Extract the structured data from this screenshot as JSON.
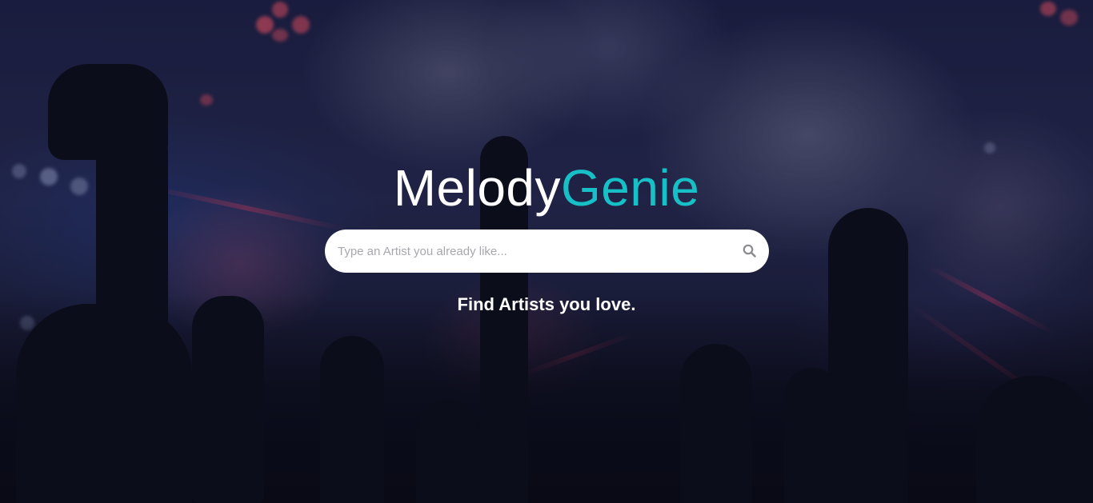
{
  "brand": {
    "name_part1": "Melody",
    "name_part2": "Genie",
    "accent_color": "#17bfc6"
  },
  "search": {
    "placeholder": "Type an Artist you already like...",
    "value": "",
    "icon": "search-icon"
  },
  "tagline": "Find Artists you love."
}
